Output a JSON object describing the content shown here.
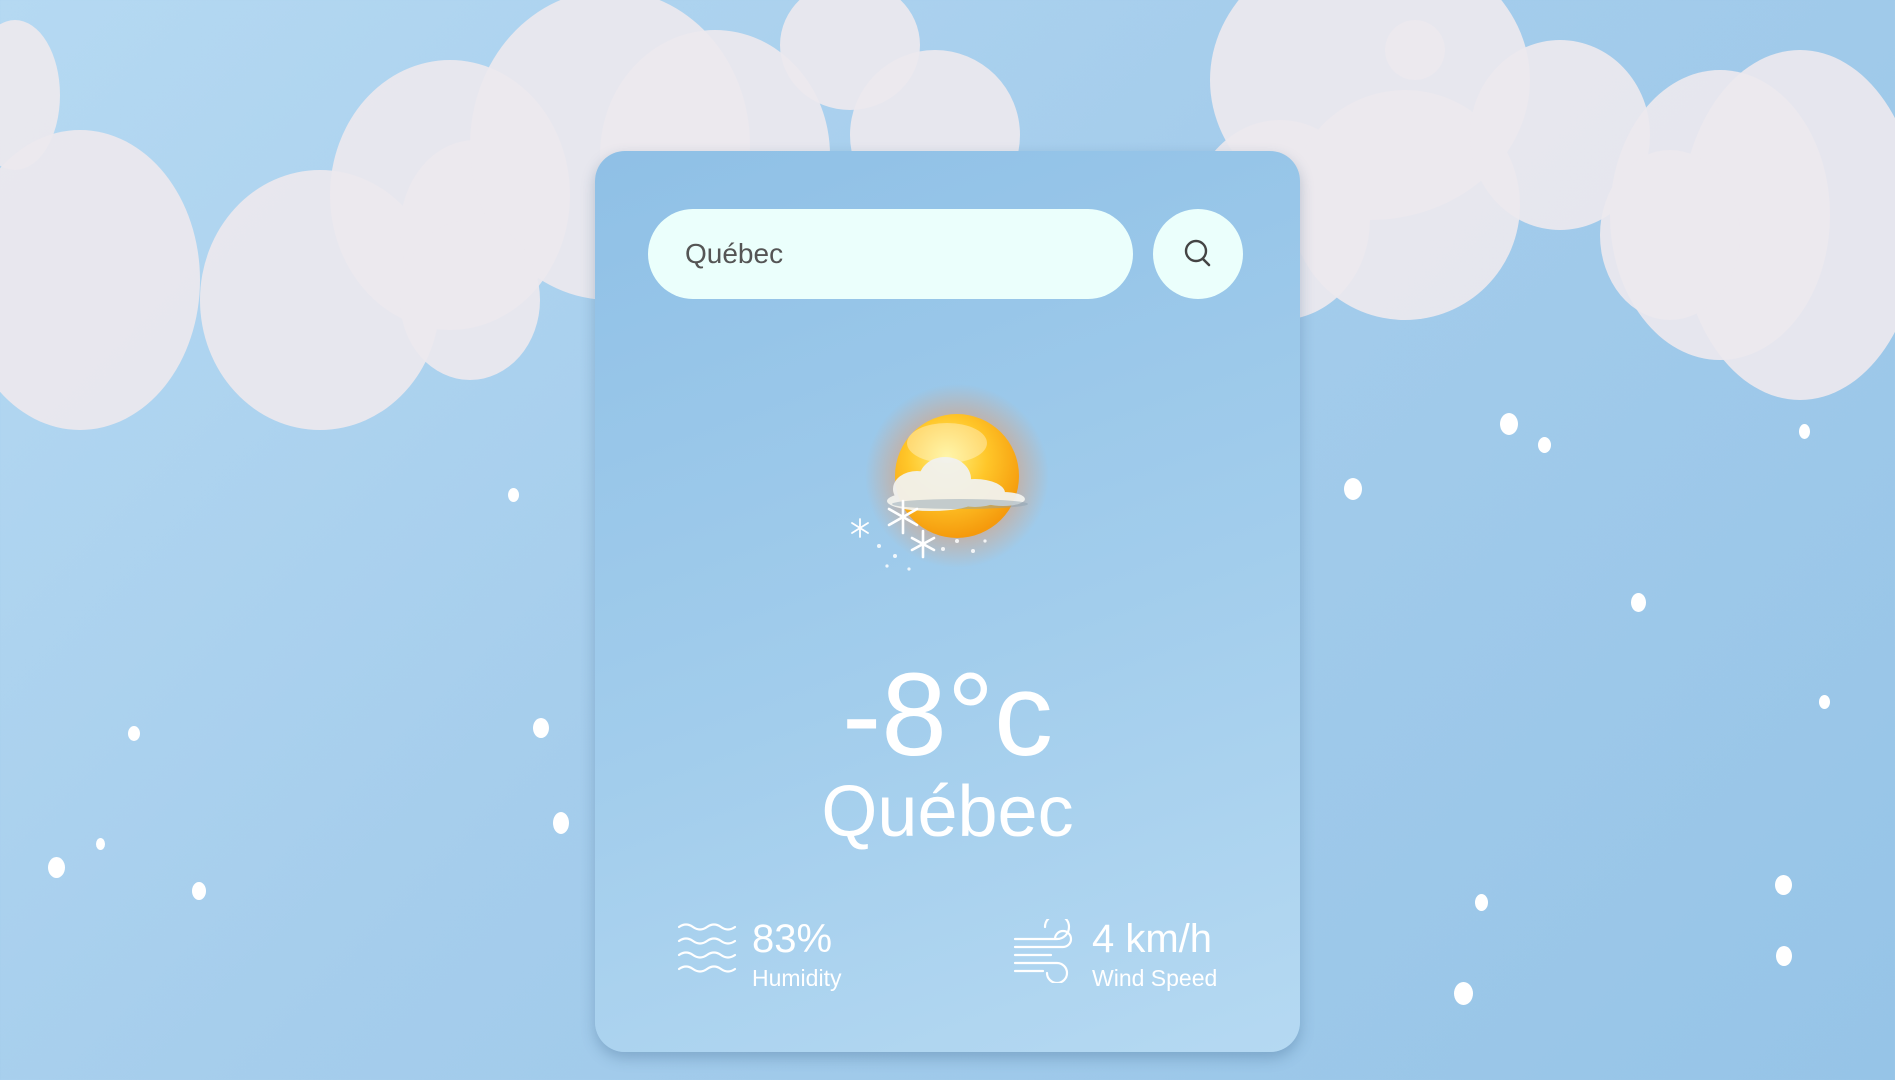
{
  "search": {
    "value": "Québec",
    "placeholder": ""
  },
  "weather": {
    "icon": "sun-cloud-snow-icon",
    "temperature": "-8°c",
    "city": "Québec"
  },
  "details": {
    "humidity": {
      "value": "83%",
      "label": "Humidity",
      "icon": "humidity-waves-icon"
    },
    "wind": {
      "value": "4 km/h",
      "label": "Wind Speed",
      "icon": "wind-icon"
    }
  },
  "colors": {
    "sky": "#a5cdec",
    "card": "#9fcbec",
    "input_bg": "#ebfffc",
    "cloud": "#ece8ee",
    "text": "#ffffff"
  }
}
